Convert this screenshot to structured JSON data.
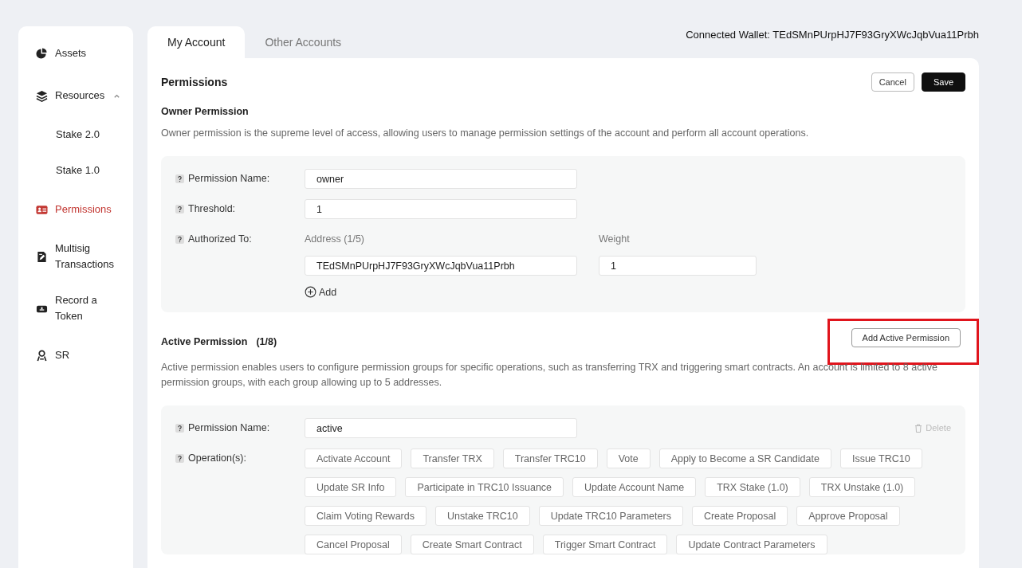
{
  "sidebar": {
    "items": [
      {
        "label": "Assets",
        "selected": false
      },
      {
        "label": "Resources",
        "selected": false,
        "expanded": true,
        "children": [
          {
            "label": "Stake 2.0",
            "selected": false
          },
          {
            "label": "Stake 1.0",
            "selected": false
          }
        ]
      },
      {
        "label": "Permissions",
        "selected": true
      },
      {
        "label": "Multisig Transactions",
        "selected": false
      },
      {
        "label": "Record a Token",
        "selected": false
      },
      {
        "label": "SR",
        "selected": false
      }
    ]
  },
  "tabs": [
    {
      "label": "My Account",
      "selected": true
    },
    {
      "label": "Other Accounts",
      "selected": false
    }
  ],
  "connected_wallet": "Connected Wallet: TEdSMnPUrpHJ7F93GryXWcJqbVua11Prbh",
  "panel": {
    "title": "Permissions",
    "buttons": [
      {
        "label": "Cancel",
        "kind": "outline"
      },
      {
        "label": "Save",
        "kind": "primary"
      }
    ]
  },
  "owner": {
    "title": "Owner Permission",
    "description": "Owner permission is the supreme level of access, allowing users to manage permission settings of the account and perform all account operations.",
    "name_label": "Permission Name:",
    "name_value": "owner",
    "threshold_label": "Threshold:",
    "threshold_value": "1",
    "authorized_label": "Authorized To:",
    "address_header": "Address (1/5)",
    "weight_header": "Weight",
    "keys": [
      {
        "address": "TEdSMnPUrpHJ7F93GryXWcJqbVua11Prbh",
        "weight": "1"
      }
    ],
    "add": "Add"
  },
  "active": {
    "title": "Active Permission",
    "count": "(1/8)",
    "add_button": "Add Active Permission",
    "highlighted": true,
    "description": "Active permission enables users to configure permission groups for specific operations, such as transferring TRX and triggering smart contracts. An account is limited to 8 active permission groups, with each group allowing up to 5 addresses.",
    "name_label": "Permission Name:",
    "name_value": "active",
    "delete": "Delete",
    "operations_label": "Operation(s):",
    "operations": [
      {
        "label": "Activate Account",
        "selected": false
      },
      {
        "label": "Transfer TRX",
        "selected": false
      },
      {
        "label": "Transfer TRC10",
        "selected": false
      },
      {
        "label": "Vote",
        "selected": false
      },
      {
        "label": "Apply to Become a SR Candidate",
        "selected": false
      },
      {
        "label": "Issue TRC10",
        "selected": false
      },
      {
        "label": "Update SR Info",
        "selected": false
      },
      {
        "label": "Participate in TRC10 Issuance",
        "selected": false
      },
      {
        "label": "Update Account Name",
        "selected": false
      },
      {
        "label": "TRX Stake (1.0)",
        "selected": false
      },
      {
        "label": "TRX Unstake (1.0)",
        "selected": false
      },
      {
        "label": "Claim Voting Rewards",
        "selected": false
      },
      {
        "label": "Unstake TRC10",
        "selected": false
      },
      {
        "label": "Update TRC10 Parameters",
        "selected": false
      },
      {
        "label": "Create Proposal",
        "selected": false
      },
      {
        "label": "Approve Proposal",
        "selected": false
      },
      {
        "label": "Cancel Proposal",
        "selected": false
      },
      {
        "label": "Create Smart Contract",
        "selected": false
      },
      {
        "label": "Trigger Smart Contract",
        "selected": false
      },
      {
        "label": "Update Contract Parameters",
        "selected": false
      }
    ]
  }
}
